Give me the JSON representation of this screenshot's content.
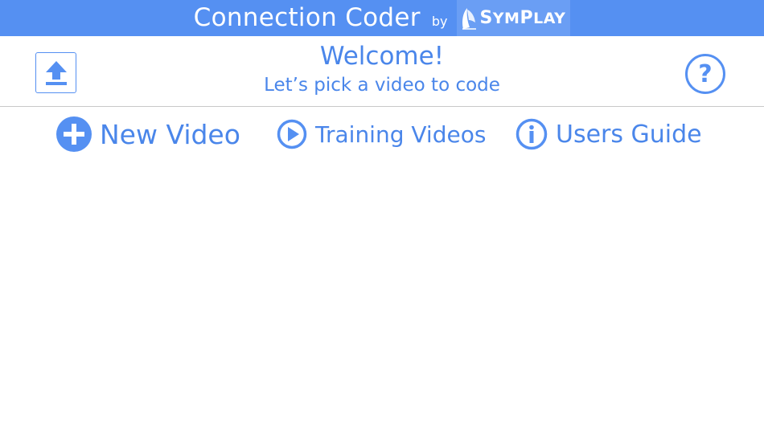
{
  "titlebar": {
    "app_title": "Connection Coder",
    "by": "by",
    "brand": "SymPlay",
    "brand_first": "S",
    "brand_mid": "YM",
    "brand_p": "P",
    "brand_end": "LAY"
  },
  "header": {
    "welcome": "Welcome!",
    "subtitle": "Let’s pick a video to code",
    "upload_icon": "upload-icon",
    "help_icon": "help-icon",
    "help_glyph": "?"
  },
  "actions": {
    "new_video": {
      "label": "New Video",
      "icon": "plus-circle-icon"
    },
    "training_videos": {
      "label": "Training Videos",
      "icon": "play-circle-icon"
    },
    "users_guide": {
      "label": "Users Guide",
      "icon": "info-circle-icon"
    }
  },
  "colors": {
    "accent": "#5590f2",
    "text": "#4a86ea",
    "background": "#ffffff",
    "divider": "#c8c8c8"
  }
}
